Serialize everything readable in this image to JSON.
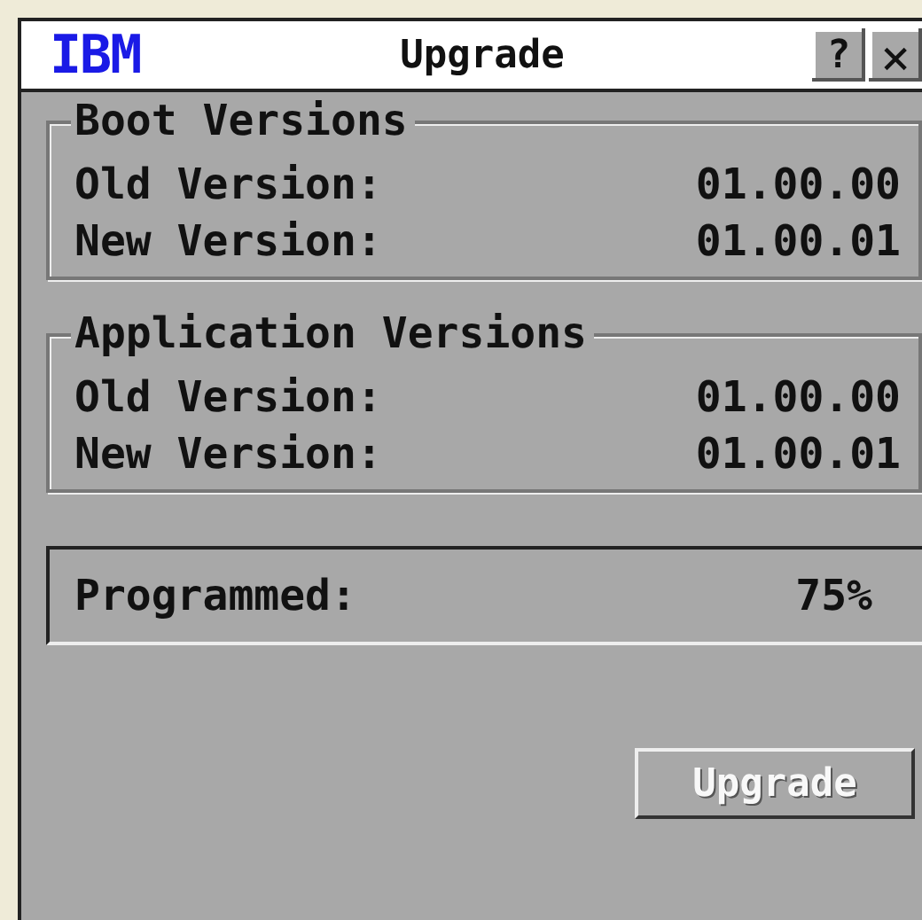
{
  "window": {
    "logo": "IBM",
    "title": "Upgrade",
    "help_button": "?",
    "close_button": "×"
  },
  "groups": [
    {
      "title": "Boot Versions",
      "rows": [
        {
          "label": "Old Version:",
          "value": "01.00.00"
        },
        {
          "label": "New Version:",
          "value": "01.00.01"
        }
      ]
    },
    {
      "title": "Application Versions",
      "rows": [
        {
          "label": "Old Version:",
          "value": "01.00.00"
        },
        {
          "label": "New Version:",
          "value": "01.00.01"
        }
      ]
    }
  ],
  "progress": {
    "label": "Programmed:",
    "value": "75%"
  },
  "buttons": [
    {
      "label": "Upgrade",
      "disabled": true
    }
  ]
}
